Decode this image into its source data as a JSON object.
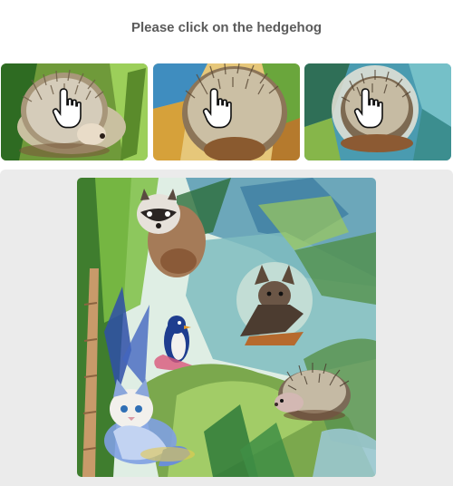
{
  "captcha": {
    "prompt": "Please click on the hedgehog",
    "examples": [
      {
        "subject": "hedgehog",
        "cursor_icon": "hand-pointer-icon"
      },
      {
        "subject": "hedgehog",
        "cursor_icon": "hand-pointer-icon"
      },
      {
        "subject": "hedgehog",
        "cursor_icon": "hand-pointer-icon"
      }
    ],
    "puzzle_image": {
      "style": "watercolor jungle scene",
      "animals": [
        "raccoon",
        "bat",
        "penguin",
        "cat",
        "hedgehog"
      ]
    }
  },
  "colors": {
    "title": "#5b5b5b",
    "panel_bg": "#ebebeb",
    "page_bg": "#ffffff"
  }
}
